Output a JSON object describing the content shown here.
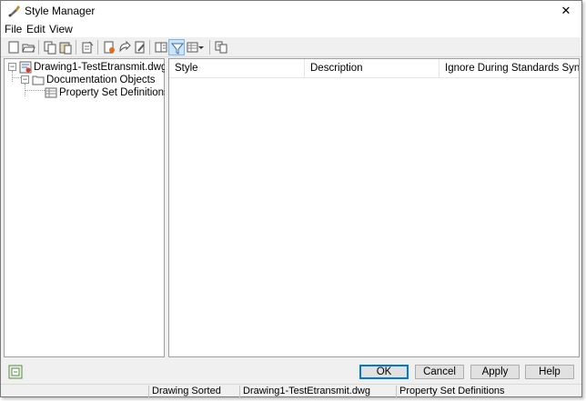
{
  "window": {
    "title": "Style Manager",
    "close_glyph": "✕"
  },
  "menu": {
    "items": [
      "File",
      "Edit",
      "View"
    ]
  },
  "toolbar": {
    "buttons": [
      "new-drawing-icon",
      "open-drawing-icon",
      "copy-icon",
      "paste-icon",
      "purge-styles-icon",
      "new-style-icon",
      "set-from-icon",
      "edit-style-icon",
      "toggle-view-icon",
      "filter-style-type-icon",
      "show-display-representations-icon",
      "view-options-dropdown-icon",
      "synchronize-icon"
    ]
  },
  "tree": {
    "root": {
      "label": "Drawing1-TestEtransmit.dwg",
      "expanded": true,
      "expander": "−"
    },
    "child": {
      "label": "Documentation Objects",
      "expanded": true,
      "expander": "−"
    },
    "grandchild": {
      "label": "Property Set Definitions",
      "selected": false
    }
  },
  "list": {
    "columns": [
      "Style",
      "Description",
      "Ignore During Standards Synchroni..."
    ],
    "rows": []
  },
  "buttons": {
    "ok": "OK",
    "cancel": "Cancel",
    "apply": "Apply",
    "help": "Help"
  },
  "status": {
    "sort_state": "Drawing Sorted",
    "drawing": "Drawing1-TestEtransmit.dwg",
    "category": "Property Set Definitions"
  },
  "colors": {
    "accent": "#0078d7",
    "toolbar_active": "#cce4f7"
  }
}
